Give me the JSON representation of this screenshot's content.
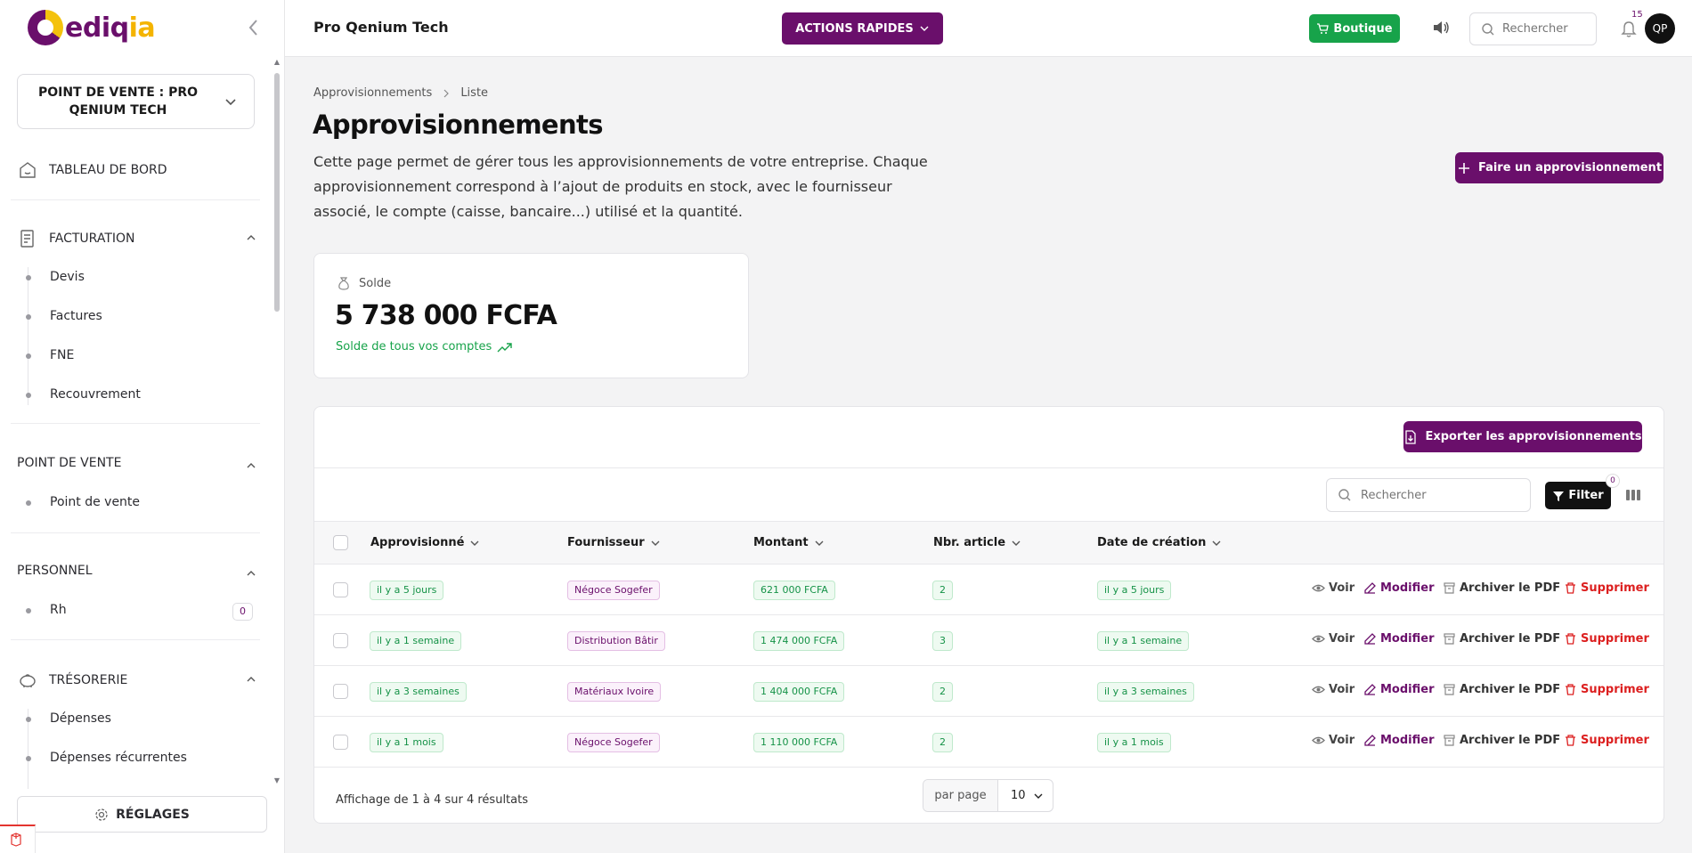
{
  "logo": {
    "main": "ediq",
    "accent": "ia"
  },
  "header": {
    "company": "Pro Qenium Tech",
    "quick_actions": "ACTIONS RAPIDES",
    "shop": "Boutique",
    "search_placeholder": "Rechercher",
    "notifications_count": "15",
    "avatar": "QP"
  },
  "sidebar": {
    "point_of_sale_select": "POINT DE VENTE : PRO QENIUM TECH",
    "dashboard": "TABLEAU DE BORD",
    "sections": [
      {
        "title": "FACTURATION",
        "items": [
          "Devis",
          "Factures",
          "FNE",
          "Recouvrement"
        ]
      },
      {
        "title": "POINT DE VENTE",
        "items": [
          "Point de vente"
        ]
      },
      {
        "title": "PERSONNEL",
        "items": [
          "Rh"
        ],
        "rh_badge": "0"
      },
      {
        "title": "TRÉSORERIE",
        "items": [
          "Dépenses",
          "Dépenses récurrentes"
        ]
      }
    ],
    "settings": "RÉGLAGES"
  },
  "breadcrumb": {
    "parent": "Approvisionnements",
    "current": "Liste"
  },
  "page": {
    "title": "Approvisionnements",
    "description": "Cette page permet de gérer tous les approvisionnements de votre entreprise. Chaque approvisionnement correspond à l’ajout de produits en stock, avec le fournisseur associé, le compte (caisse, bancaire...) utilisé et la quantité.",
    "add_button": "Faire un approvisionnement"
  },
  "balance_card": {
    "label": "Solde",
    "amount": "5 738 000 FCFA",
    "link": "Solde de tous vos comptes"
  },
  "table": {
    "export_button": "Exporter les approvisionnements",
    "search_placeholder": "Rechercher",
    "filter_label": "Filter",
    "filter_count": "0",
    "columns": [
      "Approvisionné",
      "Fournisseur",
      "Montant",
      "Nbr. article",
      "Date de création"
    ],
    "rows": [
      {
        "supplied": "il y a 5 jours",
        "supplier": "Négoce Sogefer",
        "amount": "621 000 FCFA",
        "items": "2",
        "created": "il y a 5 jours"
      },
      {
        "supplied": "il y a 1 semaine",
        "supplier": "Distribution Bâtir",
        "amount": "1 474 000 FCFA",
        "items": "3",
        "created": "il y a 1 semaine"
      },
      {
        "supplied": "il y a 3 semaines",
        "supplier": "Matériaux Ivoire",
        "amount": "1 404 000 FCFA",
        "items": "2",
        "created": "il y a 3 semaines"
      },
      {
        "supplied": "il y a 1 mois",
        "supplier": "Négoce Sogefer",
        "amount": "1 110 000 FCFA",
        "items": "2",
        "created": "il y a 1 mois"
      }
    ],
    "actions": {
      "view": "Voir",
      "edit": "Modifier",
      "archive": "Archiver le PDF",
      "delete": "Supprimer"
    },
    "summary": "Affichage de 1 à 4 sur 4 résultats",
    "per_page_label": "par page",
    "per_page_value": "10"
  },
  "colors": {
    "brand": "#6a0f6b",
    "accent": "#f4b400",
    "success": "#17a34a",
    "danger": "#dc1f1f"
  }
}
